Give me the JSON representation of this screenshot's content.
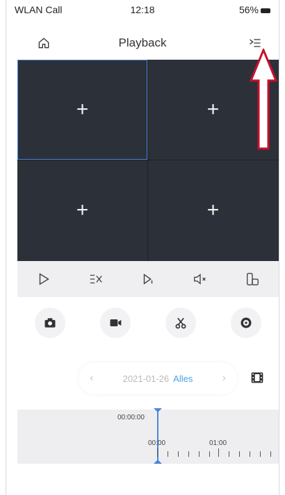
{
  "status": {
    "carrier": "WLAN Call",
    "time": "12:18",
    "battery": "56%"
  },
  "header": {
    "title": "Playback"
  },
  "grid": {
    "cells": [
      "+",
      "+",
      "+",
      "+"
    ]
  },
  "date": {
    "value": "2021-01-26",
    "filter": "Alles"
  },
  "timeline": {
    "current": "00:00:00",
    "ticks": [
      "00:00",
      "01:00"
    ]
  },
  "colors": {
    "grid_bg": "#2c3039",
    "accent": "#4a86d8",
    "annotation": "#c8102e"
  },
  "icons": [
    "home-icon",
    "list-menu-icon",
    "play-icon",
    "split-view-icon",
    "step-icon",
    "mute-icon",
    "rotate-icon",
    "camera-icon",
    "video-record-icon",
    "scissors-icon",
    "stream-icon",
    "prev-icon",
    "next-icon",
    "film-icon"
  ]
}
